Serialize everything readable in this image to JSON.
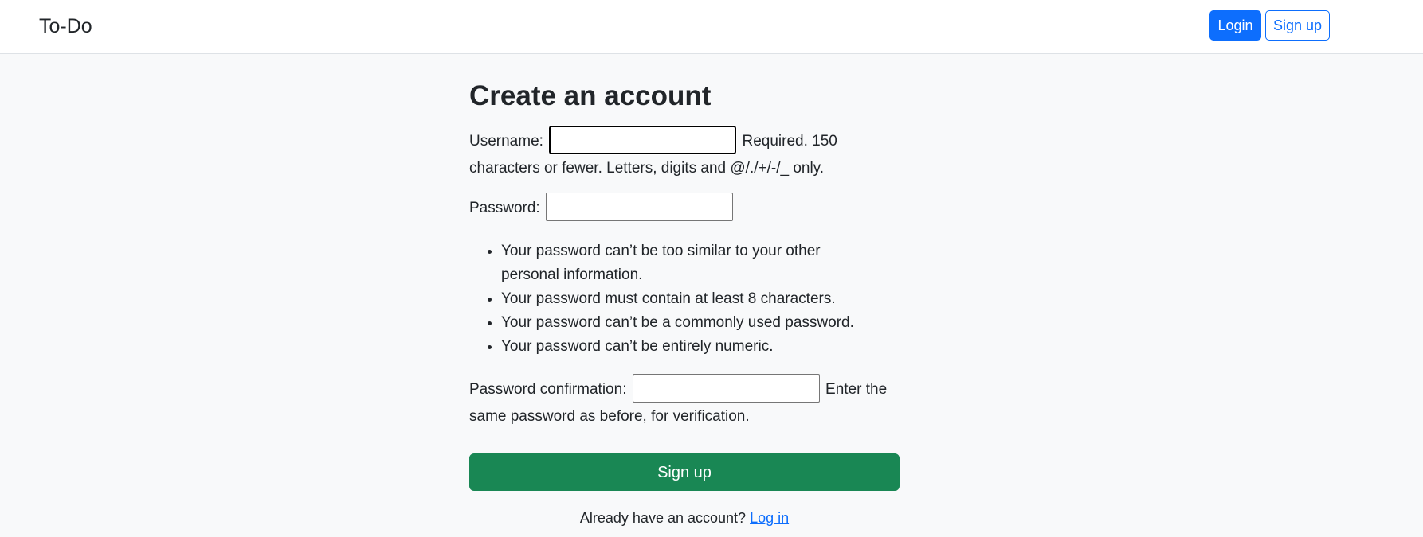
{
  "navbar": {
    "brand": "To-Do",
    "login_label": "Login",
    "signup_label": "Sign up"
  },
  "form": {
    "title": "Create an account",
    "username": {
      "label": "Username:",
      "value": "",
      "help": "Required. 150 characters or fewer. Letters, digits and @/./+/-/_ only."
    },
    "password": {
      "label": "Password:",
      "value": "",
      "help_items": [
        "Your password can’t be too similar to your other personal information.",
        "Your password must contain at least 8 characters.",
        "Your password can’t be a commonly used password.",
        "Your password can’t be entirely numeric."
      ]
    },
    "password_confirmation": {
      "label": "Password confirmation:",
      "value": "",
      "help": "Enter the same password as before, for verification."
    },
    "submit_label": "Sign up",
    "already_text": "Already have an account?",
    "login_link": "Log in"
  },
  "colors": {
    "primary": "#0d6efd",
    "success": "#198754",
    "page_background": "#f8f9fa"
  }
}
